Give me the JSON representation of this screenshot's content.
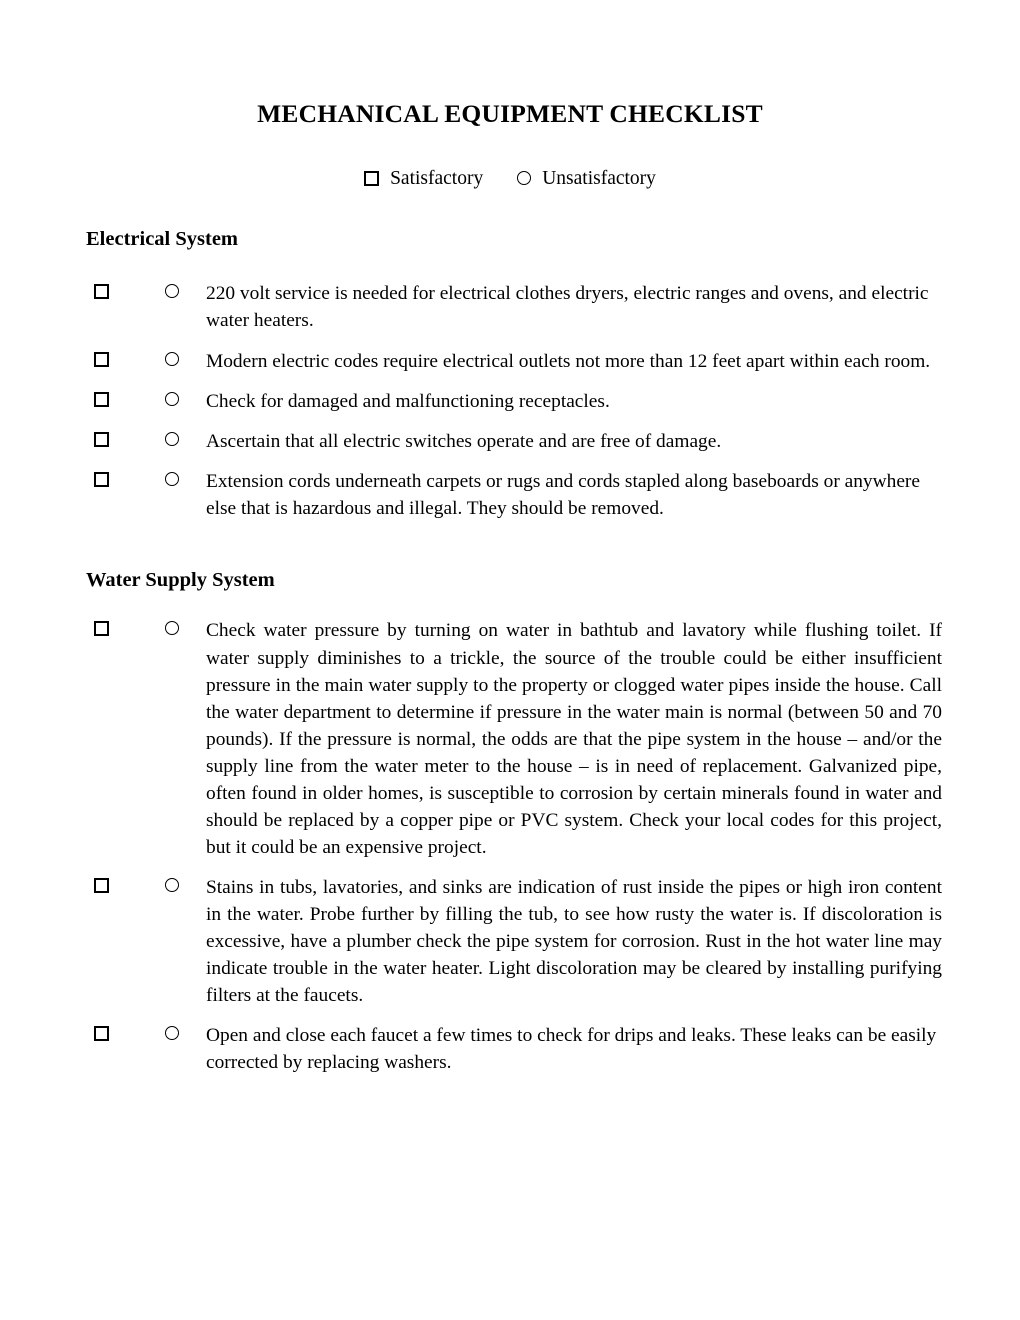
{
  "document": {
    "title": "MECHANICAL EQUIPMENT CHECKLIST"
  },
  "legend": {
    "entries": [
      {
        "marker": "square-checkbox-icon",
        "label": "Satisfactory"
      },
      {
        "marker": "circle-checkbox-icon",
        "label": "Unsatisfactory"
      }
    ]
  },
  "sections": [
    {
      "id": "electrical-system",
      "heading": "Electrical System",
      "items": [
        {
          "marker_satisfactory": "square-checkbox-icon",
          "marker_unsatisfactory": "circle-checkbox-icon",
          "text": "220 volt service is needed for electrical clothes dryers, electric ranges and ovens, and electric water heaters.",
          "justified": false
        },
        {
          "marker_satisfactory": "square-checkbox-icon",
          "marker_unsatisfactory": "circle-checkbox-icon",
          "text": "Modern electric codes require electrical outlets not more than 12 feet apart within each room.",
          "justified": false
        },
        {
          "marker_satisfactory": "square-checkbox-icon",
          "marker_unsatisfactory": "circle-checkbox-icon",
          "text": "Check for damaged and malfunctioning receptacles.",
          "justified": false
        },
        {
          "marker_satisfactory": "square-checkbox-icon",
          "marker_unsatisfactory": "circle-checkbox-icon",
          "text": "Ascertain that all electric switches operate and are free of damage.",
          "justified": false
        },
        {
          "marker_satisfactory": "square-checkbox-icon",
          "marker_unsatisfactory": "circle-checkbox-icon",
          "text": "Extension cords underneath carpets or rugs and cords stapled along baseboards or anywhere else that is hazardous and illegal.  They should be removed.",
          "justified": false
        }
      ]
    },
    {
      "id": "water-supply-system",
      "heading": "Water Supply System",
      "items": [
        {
          "marker_satisfactory": "square-checkbox-icon",
          "marker_unsatisfactory": "circle-checkbox-icon",
          "text": "Check water pressure by turning on water in bathtub and lavatory while flushing toilet.  If water supply diminishes to a trickle, the source of the trouble could be either insufficient pressure in the main water supply to the property or clogged water pipes inside the house.  Call the water department to determine if pressure in the water main is normal (between 50 and 70 pounds).  If the pressure is normal, the odds are that the pipe system in the house – and/or the supply line from the water meter to the house – is in need of replacement.  Galvanized pipe, often found in older homes, is susceptible to corrosion by certain minerals found in water and should be replaced by a copper pipe or PVC system.  Check your local codes for this project, but it could be an expensive project.",
          "justified": true
        },
        {
          "marker_satisfactory": "square-checkbox-icon",
          "marker_unsatisfactory": "circle-checkbox-icon",
          "text": "Stains in tubs, lavatories, and sinks are indication of rust inside the pipes or high iron content in the water.  Probe further by filling the tub, to see how rusty the water is.  If discoloration is excessive, have a plumber check the pipe system for corrosion.  Rust in the hot water line may indicate trouble in the water heater.  Light discoloration may be cleared by installing purifying filters at the faucets.",
          "justified": true
        },
        {
          "marker_satisfactory": "square-checkbox-icon",
          "marker_unsatisfactory": "circle-checkbox-icon",
          "text": "Open and close each faucet a few times to check for drips and leaks.  These leaks can be easily corrected by replacing washers.",
          "justified": false
        }
      ]
    }
  ],
  "colors": {
    "text": "#000000",
    "background": "#ffffff"
  }
}
